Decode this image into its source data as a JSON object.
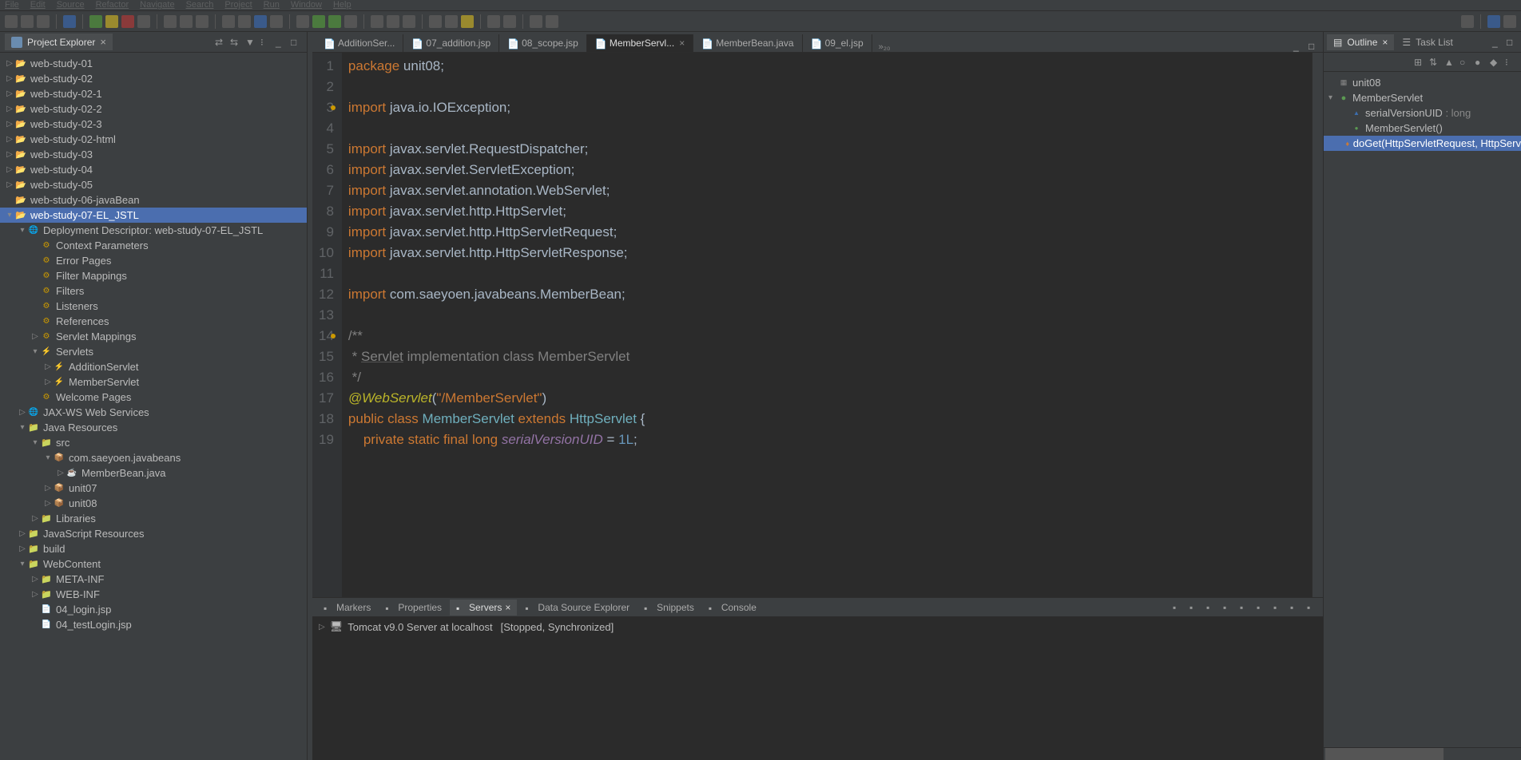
{
  "menubar": [
    "File",
    "Edit",
    "Source",
    "Refactor",
    "Navigate",
    "Search",
    "Project",
    "Run",
    "Window",
    "Help"
  ],
  "project_explorer": {
    "title": "Project Explorer",
    "items": [
      {
        "depth": 0,
        "exp": "▷",
        "icon": "proj",
        "label": "web-study-01"
      },
      {
        "depth": 0,
        "exp": "▷",
        "icon": "proj",
        "label": "web-study-02"
      },
      {
        "depth": 0,
        "exp": "▷",
        "icon": "proj",
        "label": "web-study-02-1"
      },
      {
        "depth": 0,
        "exp": "▷",
        "icon": "proj",
        "label": "web-study-02-2"
      },
      {
        "depth": 0,
        "exp": "▷",
        "icon": "proj",
        "label": "web-study-02-3"
      },
      {
        "depth": 0,
        "exp": "▷",
        "icon": "proj",
        "label": "web-study-02-html"
      },
      {
        "depth": 0,
        "exp": "▷",
        "icon": "proj",
        "label": "web-study-03"
      },
      {
        "depth": 0,
        "exp": "▷",
        "icon": "proj",
        "label": "web-study-04"
      },
      {
        "depth": 0,
        "exp": "▷",
        "icon": "proj",
        "label": "web-study-05"
      },
      {
        "depth": 0,
        "exp": "",
        "icon": "proj",
        "label": "web-study-06-javaBean"
      },
      {
        "depth": 0,
        "exp": "▾",
        "icon": "proj",
        "label": "web-study-07-EL_JSTL",
        "selected": true
      },
      {
        "depth": 1,
        "exp": "▾",
        "icon": "globe",
        "label": "Deployment Descriptor: web-study-07-EL_JSTL"
      },
      {
        "depth": 2,
        "exp": "",
        "icon": "cfg",
        "label": "Context Parameters"
      },
      {
        "depth": 2,
        "exp": "",
        "icon": "cfg",
        "label": "Error Pages"
      },
      {
        "depth": 2,
        "exp": "",
        "icon": "cfg",
        "label": "Filter Mappings"
      },
      {
        "depth": 2,
        "exp": "",
        "icon": "cfg",
        "label": "Filters"
      },
      {
        "depth": 2,
        "exp": "",
        "icon": "cfg",
        "label": "Listeners"
      },
      {
        "depth": 2,
        "exp": "",
        "icon": "cfg",
        "label": "References"
      },
      {
        "depth": 2,
        "exp": "▷",
        "icon": "cfg",
        "label": "Servlet Mappings"
      },
      {
        "depth": 2,
        "exp": "▾",
        "icon": "srv",
        "label": "Servlets"
      },
      {
        "depth": 3,
        "exp": "▷",
        "icon": "srv",
        "label": "AdditionServlet"
      },
      {
        "depth": 3,
        "exp": "▷",
        "icon": "srv",
        "label": "MemberServlet"
      },
      {
        "depth": 2,
        "exp": "",
        "icon": "cfg",
        "label": "Welcome Pages"
      },
      {
        "depth": 1,
        "exp": "▷",
        "icon": "globe",
        "label": "JAX-WS Web Services"
      },
      {
        "depth": 1,
        "exp": "▾",
        "icon": "folder",
        "label": "Java Resources"
      },
      {
        "depth": 2,
        "exp": "▾",
        "icon": "folder",
        "label": "src"
      },
      {
        "depth": 3,
        "exp": "▾",
        "icon": "pkg",
        "label": "com.saeyoen.javabeans"
      },
      {
        "depth": 4,
        "exp": "▷",
        "icon": "java",
        "label": "MemberBean.java"
      },
      {
        "depth": 3,
        "exp": "▷",
        "icon": "pkg",
        "label": "unit07"
      },
      {
        "depth": 3,
        "exp": "▷",
        "icon": "pkg",
        "label": "unit08"
      },
      {
        "depth": 2,
        "exp": "▷",
        "icon": "folder",
        "label": "Libraries"
      },
      {
        "depth": 1,
        "exp": "▷",
        "icon": "folder",
        "label": "JavaScript Resources"
      },
      {
        "depth": 1,
        "exp": "▷",
        "icon": "folder",
        "label": "build"
      },
      {
        "depth": 1,
        "exp": "▾",
        "icon": "folder",
        "label": "WebContent"
      },
      {
        "depth": 2,
        "exp": "▷",
        "icon": "folder",
        "label": "META-INF"
      },
      {
        "depth": 2,
        "exp": "▷",
        "icon": "folder",
        "label": "WEB-INF"
      },
      {
        "depth": 2,
        "exp": "",
        "icon": "jsp",
        "label": "04_login.jsp"
      },
      {
        "depth": 2,
        "exp": "",
        "icon": "jsp",
        "label": "04_testLogin.jsp"
      }
    ]
  },
  "editor": {
    "tabs": [
      {
        "label": "AdditionSer...",
        "active": false
      },
      {
        "label": "07_addition.jsp",
        "active": false
      },
      {
        "label": "08_scope.jsp",
        "active": false
      },
      {
        "label": "MemberServl...",
        "active": true,
        "close": true
      },
      {
        "label": "MemberBean.java",
        "active": false
      },
      {
        "label": "09_el.jsp",
        "active": false
      }
    ],
    "more": "»₂₀",
    "lines": [
      {
        "n": 1,
        "html": "<span class='kw'>package</span> unit08;"
      },
      {
        "n": 2,
        "html": ""
      },
      {
        "n": 3,
        "marker": true,
        "html": "<span class='kw'>import</span> java.io.IOException;"
      },
      {
        "n": 4,
        "html": ""
      },
      {
        "n": 5,
        "html": "<span class='kw'>import</span> javax.servlet.RequestDispatcher;"
      },
      {
        "n": 6,
        "html": "<span class='kw'>import</span> javax.servlet.ServletException;"
      },
      {
        "n": 7,
        "html": "<span class='kw'>import</span> javax.servlet.annotation.WebServlet;"
      },
      {
        "n": 8,
        "html": "<span class='kw'>import</span> javax.servlet.http.HttpServlet;"
      },
      {
        "n": 9,
        "html": "<span class='kw'>import</span> javax.servlet.http.HttpServletRequest;"
      },
      {
        "n": 10,
        "html": "<span class='kw'>import</span> javax.servlet.http.HttpServletResponse;"
      },
      {
        "n": 11,
        "html": ""
      },
      {
        "n": 12,
        "html": "<span class='kw'>import</span> com.saeyoen.javabeans.MemberBean;"
      },
      {
        "n": 13,
        "html": ""
      },
      {
        "n": 14,
        "marker": true,
        "html": "<span class='cmt'>/**</span>"
      },
      {
        "n": 15,
        "html": "<span class='cmt'> * <span class='ul'>Servlet</span> implementation class MemberServlet</span>"
      },
      {
        "n": 16,
        "html": "<span class='cmt'> */</span>"
      },
      {
        "n": 17,
        "html": "<span class='ann'>@WebServlet</span>(<span class='str'>\"/MemberServlet\"</span>)"
      },
      {
        "n": 18,
        "html": "<span class='kw'>public</span> <span class='kw'>class</span> <span class='cls'>MemberServlet</span> <span class='kw'>extends</span> <span class='cls'>HttpServlet</span> {"
      },
      {
        "n": 19,
        "html": "    <span class='kw'>private</span> <span class='kw'>static</span> <span class='kw'>final</span> <span class='kw'>long</span> <span class='field'>serialVersionUID</span> = <span class='num'>1L</span>;"
      }
    ]
  },
  "bottom": {
    "tabs": [
      {
        "label": "Markers",
        "active": false
      },
      {
        "label": "Properties",
        "active": false
      },
      {
        "label": "Servers",
        "active": true,
        "close": true
      },
      {
        "label": "Data Source Explorer",
        "active": false
      },
      {
        "label": "Snippets",
        "active": false
      },
      {
        "label": "Console",
        "active": false
      }
    ],
    "server": {
      "name": "Tomcat v9.0 Server at localhost",
      "state": "[Stopped, Synchronized]"
    }
  },
  "outline": {
    "title": "Outline",
    "tasklist": "Task List",
    "items": [
      {
        "depth": 0,
        "icon": "pkg",
        "label": "unit08"
      },
      {
        "depth": 0,
        "exp": "▾",
        "icon": "cls",
        "label": "MemberServlet"
      },
      {
        "depth": 1,
        "icon": "field",
        "label": "serialVersionUID",
        "type": " : long"
      },
      {
        "depth": 1,
        "icon": "ctor",
        "label": "MemberServlet()"
      },
      {
        "depth": 1,
        "icon": "method",
        "label": "doGet(HttpServletRequest, HttpServ",
        "selected": true
      }
    ]
  }
}
